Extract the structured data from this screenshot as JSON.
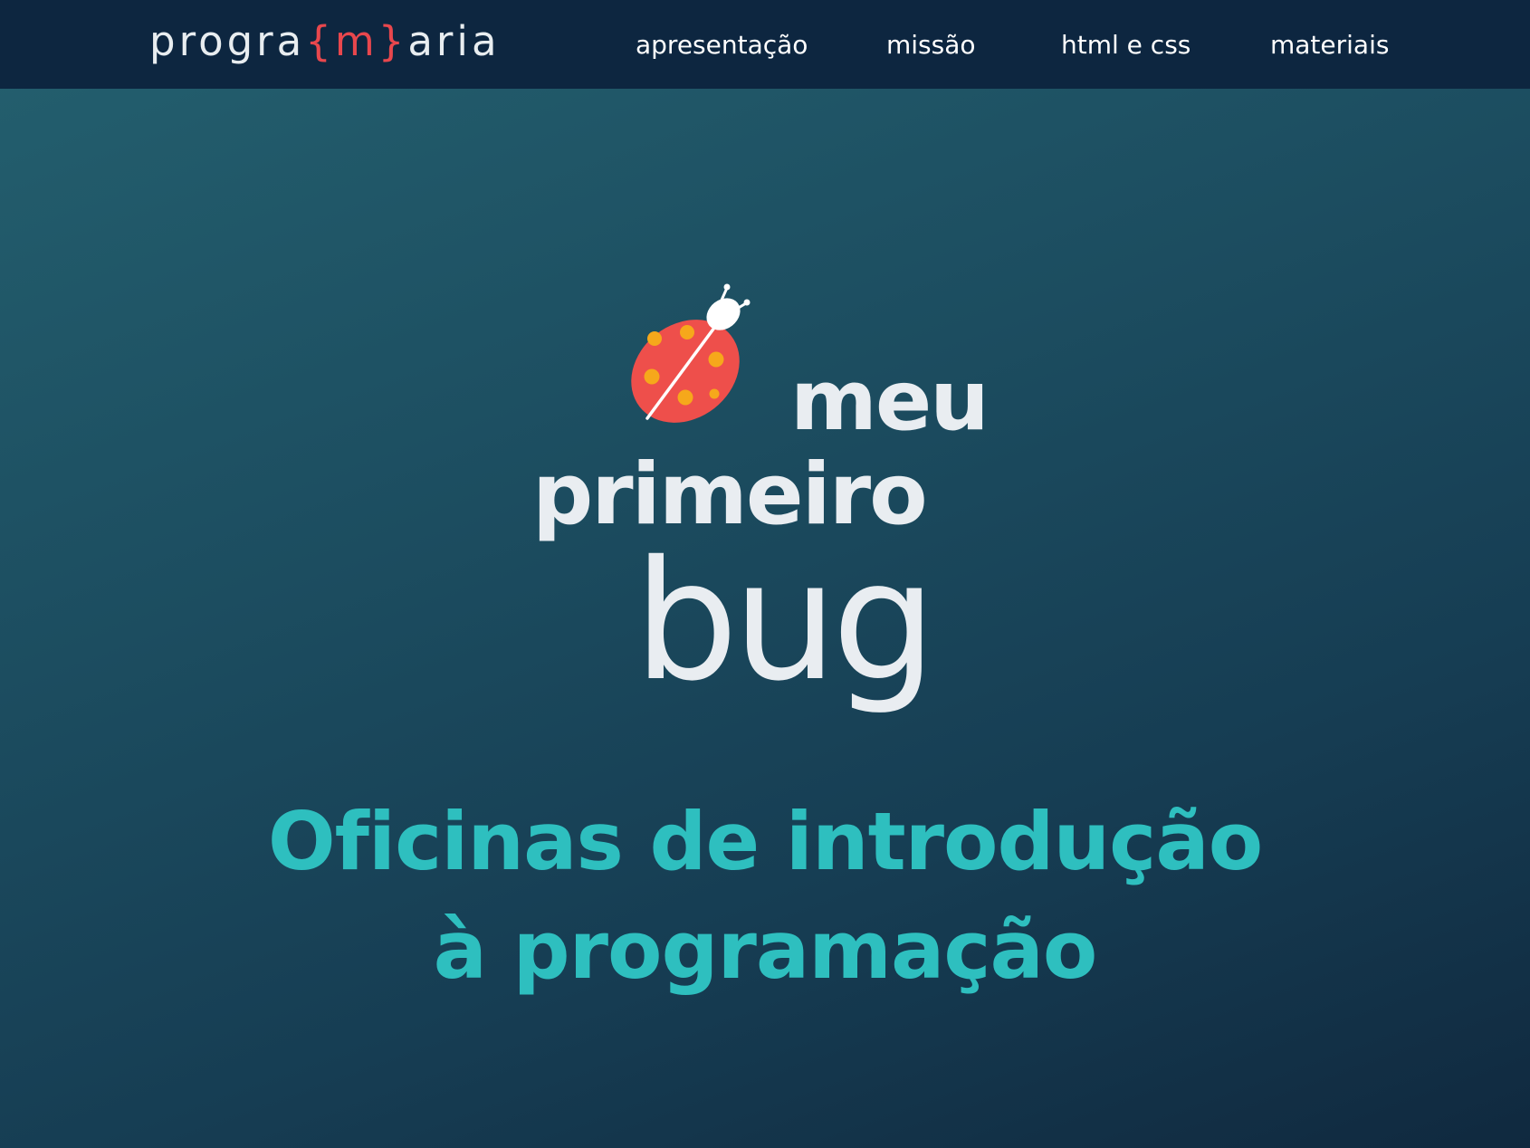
{
  "header": {
    "logo": {
      "part1": "progra",
      "accent": "{m}",
      "part2": "aria"
    },
    "nav": [
      {
        "label": "apresentação"
      },
      {
        "label": "missão"
      },
      {
        "label": "html e css"
      },
      {
        "label": "materiais"
      }
    ]
  },
  "hero": {
    "title_line1": "meu",
    "title_line2": "primeiro",
    "title_line3": "bug",
    "subtitle_line1": "Oficinas de introdução",
    "subtitle_line2": "à programação"
  },
  "colors": {
    "header_bg": "#0d2640",
    "logo_accent": "#e8474d",
    "title_text": "#e9edf1",
    "subtitle_text": "#2ebfbf",
    "ladybug_body": "#ee4f4b",
    "ladybug_spots": "#f6a81b"
  },
  "icons": {
    "hero_icon": "ladybug-icon"
  }
}
